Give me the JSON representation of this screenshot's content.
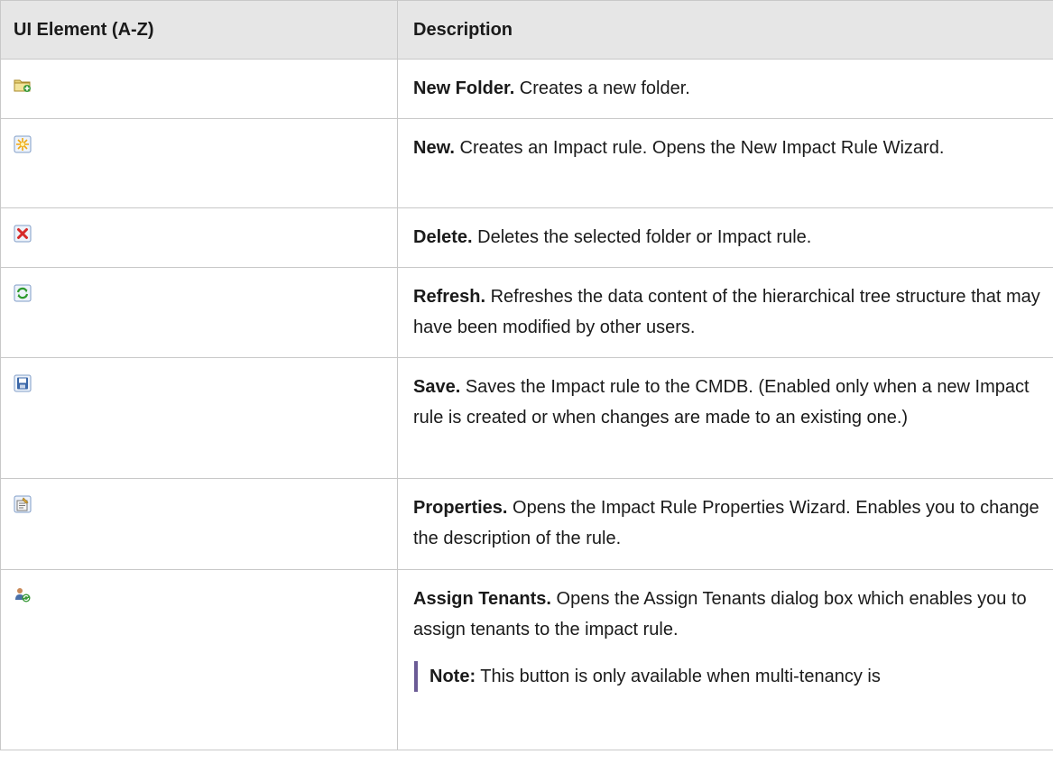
{
  "table": {
    "headers": {
      "col1": "UI Element (A-Z)",
      "col2": "Description"
    },
    "rows": [
      {
        "icon": "new-folder-icon",
        "term": "New Folder.",
        "text": " Creates a new folder."
      },
      {
        "icon": "new-icon",
        "term": "New.",
        "text": " Creates an Impact rule. Opens the New Impact Rule Wizard."
      },
      {
        "icon": "delete-icon",
        "term": "Delete.",
        "text": " Deletes the selected folder or Impact rule."
      },
      {
        "icon": "refresh-icon",
        "term": "Refresh.",
        "text": " Refreshes the data content of the hierarchical tree structure that may have been modified by other users."
      },
      {
        "icon": "save-icon",
        "term": "Save.",
        "text": " Saves the Impact rule to the CMDB. (Enabled only when a new Impact rule is created or when changes are made to an existing one.)"
      },
      {
        "icon": "properties-icon",
        "term": "Properties.",
        "text": " Opens the Impact Rule Properties Wizard. Enables you to change the description of the rule."
      },
      {
        "icon": "assign-tenants-icon",
        "term": "Assign Tenants.",
        "text": " Opens the Assign Tenants dialog box which enables you to assign tenants to the impact rule.",
        "note": {
          "label": "Note:",
          "text": "  This button is only available when multi-tenancy is"
        }
      }
    ]
  },
  "colors": {
    "header_bg": "#e6e6e6",
    "border": "#c8c8c8",
    "note_bar": "#6b5b95"
  }
}
